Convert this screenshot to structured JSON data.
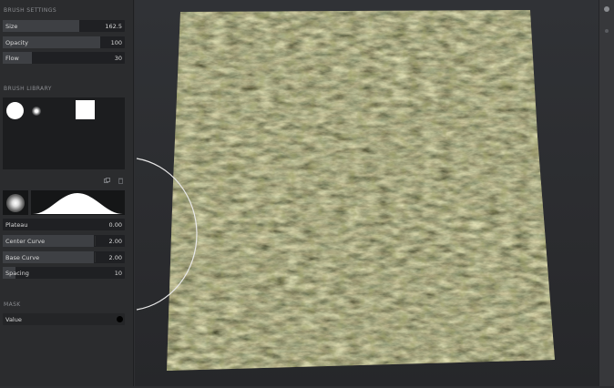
{
  "brush_settings": {
    "title": "BRUSH SETTINGS",
    "size": {
      "label": "Size",
      "value": "162.5",
      "fraction": 0.63
    },
    "opacity": {
      "label": "Opacity",
      "value": "100",
      "fraction": 0.8
    },
    "flow": {
      "label": "Flow",
      "value": "30",
      "fraction": 0.24
    }
  },
  "brush_library": {
    "title": "BRUSH LIBRARY",
    "brushes": [
      "hard-round-brush-icon",
      "soft-round-brush-icon",
      "square-brush-icon"
    ]
  },
  "brush_params": {
    "plateau": {
      "label": "Plateau",
      "value": "0.00"
    },
    "center_curve": {
      "label": "Center Curve",
      "value": "2.00"
    },
    "base_curve": {
      "label": "Base Curve",
      "value": "2.00"
    },
    "spacing": {
      "label": "Spacing",
      "value": "10"
    }
  },
  "mask": {
    "title": "MASK",
    "value": {
      "label": "Value"
    }
  },
  "colors": {
    "panel": "#2b2c2e",
    "field": "#1f2023",
    "accent": "#3e4044"
  }
}
